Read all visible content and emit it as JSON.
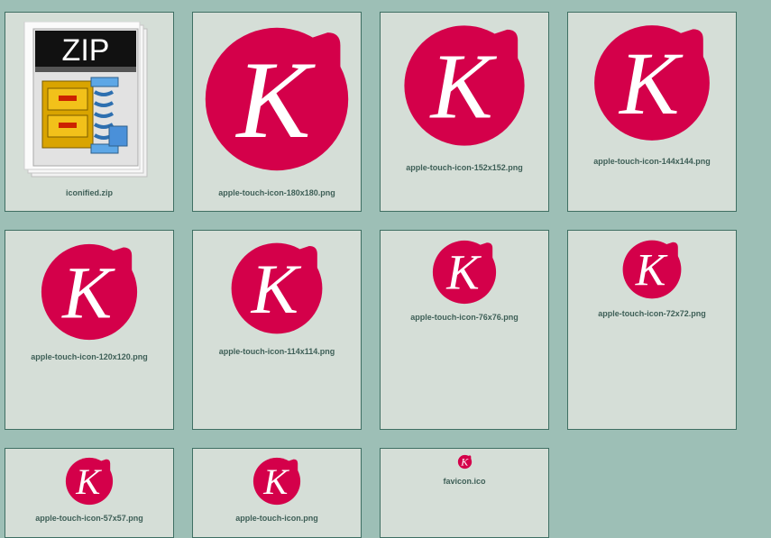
{
  "files": [
    {
      "name": "iconified.zip",
      "icon": "zip-archive-icon",
      "badge": "ZIP"
    },
    {
      "name": "apple-touch-icon-180x180.png",
      "icon": "k-logo-icon"
    },
    {
      "name": "apple-touch-icon-152x152.png",
      "icon": "k-logo-icon"
    },
    {
      "name": "apple-touch-icon-144x144.png",
      "icon": "k-logo-icon"
    },
    {
      "name": "apple-touch-icon-120x120.png",
      "icon": "k-logo-icon"
    },
    {
      "name": "apple-touch-icon-114x114.png",
      "icon": "k-logo-icon"
    },
    {
      "name": "apple-touch-icon-76x76.png",
      "icon": "k-logo-icon"
    },
    {
      "name": "apple-touch-icon-72x72.png",
      "icon": "k-logo-icon"
    },
    {
      "name": "apple-touch-icon-57x57.png",
      "icon": "k-logo-icon"
    },
    {
      "name": "apple-touch-icon.png",
      "icon": "k-logo-icon"
    },
    {
      "name": "favicon.ico",
      "icon": "k-logo-icon"
    }
  ],
  "colors": {
    "background": "#9dbfb6",
    "tile": "#d5ded7",
    "tile_border": "#3f6f63",
    "label": "#3e5f57",
    "logo_red": "#d4004a"
  }
}
